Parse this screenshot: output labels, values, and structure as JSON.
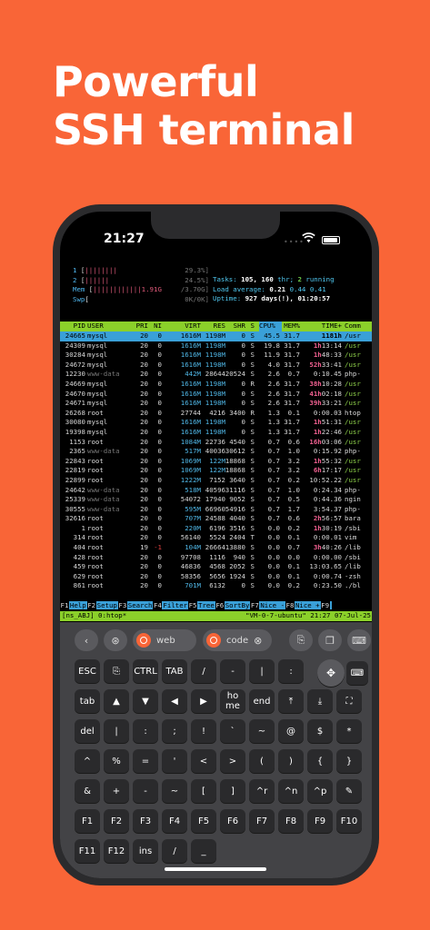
{
  "headline": {
    "line1": "Powerful",
    "line2": "SSH terminal"
  },
  "status_bar": {
    "time": "21:27"
  },
  "htop": {
    "meters": [
      {
        "label": "1",
        "bar": "||||||||",
        "value": "29.3%"
      },
      {
        "label": "2",
        "bar": "||||||",
        "value": "24.5%"
      },
      {
        "label": "Mem",
        "bar": "||||||||||||1.91G",
        "value": "/3.70G"
      },
      {
        "label": "Swp",
        "bar": "",
        "value": "0K/0K"
      }
    ],
    "tasks_label": "Tasks:",
    "tasks": "105,",
    "thr": "160",
    "thr_label": "thr;",
    "running": "2",
    "running_label": "running",
    "load_label": "Load average:",
    "load1": "0.21",
    "load5": "0.44",
    "load15": "0.41",
    "uptime_label": "Uptime:",
    "uptime": "927 days(!), 01:20:57",
    "columns": [
      "PID",
      "USER",
      "PRI",
      "NI",
      "VIRT",
      "RES",
      "SHR",
      "S",
      "CPU%",
      "MEM%",
      "TIME+",
      "Comm"
    ],
    "rows": [
      [
        "24665",
        "mysql",
        "20",
        "0",
        "1616M",
        "1198M",
        "0",
        "S",
        "45.5",
        "31.7",
        "1181h",
        "/usr"
      ],
      [
        "24309",
        "mysql",
        "20",
        "0",
        "1616M",
        "1198M",
        "0",
        "S",
        "19.8",
        "31.7",
        "1h13:14",
        "/usr"
      ],
      [
        "30284",
        "mysql",
        "20",
        "0",
        "1616M",
        "1198M",
        "0",
        "S",
        "11.9",
        "31.7",
        "1h48:33",
        "/usr"
      ],
      [
        "24672",
        "mysql",
        "20",
        "0",
        "1616M",
        "1198M",
        "0",
        "S",
        "4.0",
        "31.7",
        "52h33:41",
        "/usr"
      ],
      [
        "12230",
        "www-data",
        "20",
        "0",
        "442M",
        "28644",
        "20524",
        "S",
        "2.6",
        "0.7",
        "0:10.45",
        "php-"
      ],
      [
        "24669",
        "mysql",
        "20",
        "0",
        "1616M",
        "1198M",
        "0",
        "R",
        "2.6",
        "31.7",
        "38h10:28",
        "/usr"
      ],
      [
        "24670",
        "mysql",
        "20",
        "0",
        "1616M",
        "1198M",
        "0",
        "S",
        "2.6",
        "31.7",
        "41h02:18",
        "/usr"
      ],
      [
        "24671",
        "mysql",
        "20",
        "0",
        "1616M",
        "1198M",
        "0",
        "S",
        "2.6",
        "31.7",
        "39h33:21",
        "/usr"
      ],
      [
        "26268",
        "root",
        "20",
        "0",
        "27744",
        "4216",
        "3400",
        "R",
        "1.3",
        "0.1",
        "0:00.03",
        "htop"
      ],
      [
        "30080",
        "mysql",
        "20",
        "0",
        "1616M",
        "1198M",
        "0",
        "S",
        "1.3",
        "31.7",
        "1h51:31",
        "/usr"
      ],
      [
        "19398",
        "mysql",
        "20",
        "0",
        "1616M",
        "1198M",
        "0",
        "S",
        "1.3",
        "31.7",
        "1h22:46",
        "/usr"
      ],
      [
        "1153",
        "root",
        "20",
        "0",
        "1084M",
        "22736",
        "4540",
        "S",
        "0.7",
        "0.6",
        "16h03:06",
        "/usr"
      ],
      [
        "2365",
        "www-data",
        "20",
        "0",
        "517M",
        "40036",
        "30612",
        "S",
        "0.7",
        "1.0",
        "0:15.92",
        "php-"
      ],
      [
        "22843",
        "root",
        "20",
        "0",
        "1069M",
        "122M",
        "18868",
        "S",
        "0.7",
        "3.2",
        "1h55:32",
        "/usr"
      ],
      [
        "22819",
        "root",
        "20",
        "0",
        "1069M",
        "122M",
        "18868",
        "S",
        "0.7",
        "3.2",
        "6h17:17",
        "/usr"
      ],
      [
        "22899",
        "root",
        "20",
        "0",
        "1222M",
        "7152",
        "3640",
        "S",
        "0.7",
        "0.2",
        "10:52.22",
        "/usr"
      ],
      [
        "24642",
        "www-data",
        "20",
        "0",
        "518M",
        "40596",
        "31116",
        "S",
        "0.7",
        "1.0",
        "0:24.34",
        "php-"
      ],
      [
        "25339",
        "www-data",
        "20",
        "0",
        "54072",
        "17940",
        "9052",
        "S",
        "0.7",
        "0.5",
        "0:44.36",
        "ngin"
      ],
      [
        "30555",
        "www-data",
        "20",
        "0",
        "595M",
        "66960",
        "54916",
        "S",
        "0.7",
        "1.7",
        "3:54.37",
        "php-"
      ],
      [
        "32616",
        "root",
        "20",
        "0",
        "707M",
        "24588",
        "4040",
        "S",
        "0.7",
        "0.6",
        "2h56:57",
        "bara"
      ],
      [
        "1",
        "root",
        "20",
        "0",
        "220M",
        "6196",
        "3516",
        "S",
        "0.0",
        "0.2",
        "1h30:19",
        "/sbi"
      ],
      [
        "314",
        "root",
        "20",
        "0",
        "56140",
        "5524",
        "2404",
        "T",
        "0.0",
        "0.1",
        "0:00.01",
        "vim"
      ],
      [
        "404",
        "root",
        "19",
        "-1",
        "104M",
        "26664",
        "13880",
        "S",
        "0.0",
        "0.7",
        "3h40:26",
        "/lib"
      ],
      [
        "428",
        "root",
        "20",
        "0",
        "97708",
        "1116",
        "940",
        "S",
        "0.0",
        "0.0",
        "0:00.00",
        "/sbi"
      ],
      [
        "459",
        "root",
        "20",
        "0",
        "46836",
        "4568",
        "2052",
        "S",
        "0.0",
        "0.1",
        "13:03.65",
        "/lib"
      ],
      [
        "629",
        "root",
        "20",
        "0",
        "58356",
        "5656",
        "1924",
        "S",
        "0.0",
        "0.1",
        "0:00.74",
        "-zsh"
      ],
      [
        "861",
        "root",
        "20",
        "0",
        "701M",
        "6132",
        "0",
        "S",
        "0.0",
        "0.2",
        "0:23.50",
        "./bl"
      ]
    ],
    "fkeys": [
      {
        "n": "F1",
        "t": "Help"
      },
      {
        "n": "F2",
        "t": "Setup"
      },
      {
        "n": "F3",
        "t": "Search"
      },
      {
        "n": "F4",
        "t": "Filter"
      },
      {
        "n": "F5",
        "t": "Tree"
      },
      {
        "n": "F6",
        "t": "SortBy"
      },
      {
        "n": "F7",
        "t": "Nice -"
      },
      {
        "n": "F8",
        "t": "Nice +"
      },
      {
        "n": "F9",
        "t": ""
      }
    ],
    "tmux_left": "[ns_ABJ] 0:htop*",
    "tmux_right": "\"VM-0-7-ubuntu\" 21:27 07-Jul-25"
  },
  "toolbar": {
    "back": "‹",
    "tab1": "web",
    "tab2": "code",
    "tab2_close": "⊗"
  },
  "keys": [
    [
      "ESC",
      "⎘",
      "CTRL",
      "TAB",
      "/",
      "-",
      "|",
      ":"
    ],
    [
      "tab",
      "▲",
      "▼",
      "◀",
      "▶",
      "ho\nme",
      "end",
      "⤒",
      "⤓",
      "⛶"
    ],
    [
      "del",
      "|",
      ":",
      ";",
      "!",
      "`",
      "~",
      "@",
      "$",
      "*"
    ],
    [
      "^",
      "%",
      "=",
      "'",
      "<",
      ">",
      "(",
      ")",
      "{",
      "}"
    ],
    [
      "&",
      "+",
      "-",
      "~",
      "[",
      "]",
      "^r",
      "^n",
      "^p",
      "✎"
    ],
    [
      "F1",
      "F2",
      "F3",
      "F4",
      "F5",
      "F6",
      "F7",
      "F8",
      "F9",
      "F10"
    ],
    [
      "F11",
      "F12",
      "ins",
      "/",
      "_"
    ]
  ],
  "colors": {
    "background": "#f96537",
    "selected_row": "#3aa0d8",
    "header": "#8bd02a"
  }
}
